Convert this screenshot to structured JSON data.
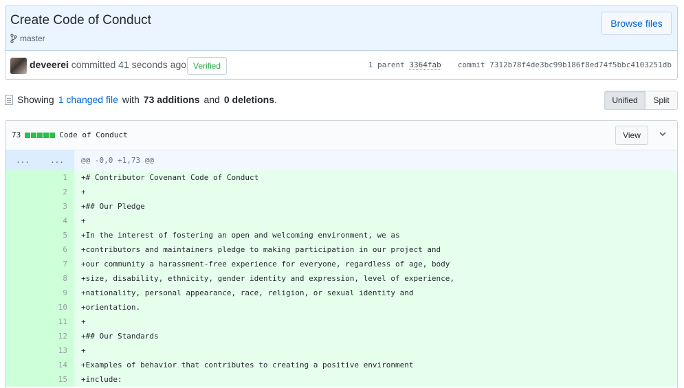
{
  "commit": {
    "title": "Create Code of Conduct",
    "branch": "master",
    "browse_label": "Browse files",
    "author": "deveerei",
    "committed_text": "committed 41 seconds ago",
    "verified_label": "Verified",
    "parent_label": "1 parent",
    "parent_sha": "3364fab",
    "commit_label": "commit",
    "commit_sha": "7312b78f4de3bc99b186f8ed74f5bbc4103251db"
  },
  "toc": {
    "showing": "Showing",
    "changed_files": "1 changed file",
    "with": "with",
    "additions": "73 additions",
    "and": "and",
    "deletions": "0 deletions",
    "period": ".",
    "unified_label": "Unified",
    "split_label": "Split"
  },
  "file": {
    "additions_count": "73",
    "name": "Code of Conduct",
    "view_label": "View",
    "hunk_left": "...",
    "hunk_right": "...",
    "hunk_header": "@@ -0,0 +1,73 @@",
    "lines": [
      {
        "num": "1",
        "text": "+# Contributor Covenant Code of Conduct"
      },
      {
        "num": "2",
        "text": "+"
      },
      {
        "num": "3",
        "text": "+## Our Pledge"
      },
      {
        "num": "4",
        "text": "+"
      },
      {
        "num": "5",
        "text": "+In the interest of fostering an open and welcoming environment, we as"
      },
      {
        "num": "6",
        "text": "+contributors and maintainers pledge to making participation in our project and"
      },
      {
        "num": "7",
        "text": "+our community a harassment-free experience for everyone, regardless of age, body"
      },
      {
        "num": "8",
        "text": "+size, disability, ethnicity, gender identity and expression, level of experience,"
      },
      {
        "num": "9",
        "text": "+nationality, personal appearance, race, religion, or sexual identity and"
      },
      {
        "num": "10",
        "text": "+orientation."
      },
      {
        "num": "11",
        "text": "+"
      },
      {
        "num": "12",
        "text": "+## Our Standards"
      },
      {
        "num": "13",
        "text": "+"
      },
      {
        "num": "14",
        "text": "+Examples of behavior that contributes to creating a positive environment"
      },
      {
        "num": "15",
        "text": "+include:"
      }
    ]
  }
}
